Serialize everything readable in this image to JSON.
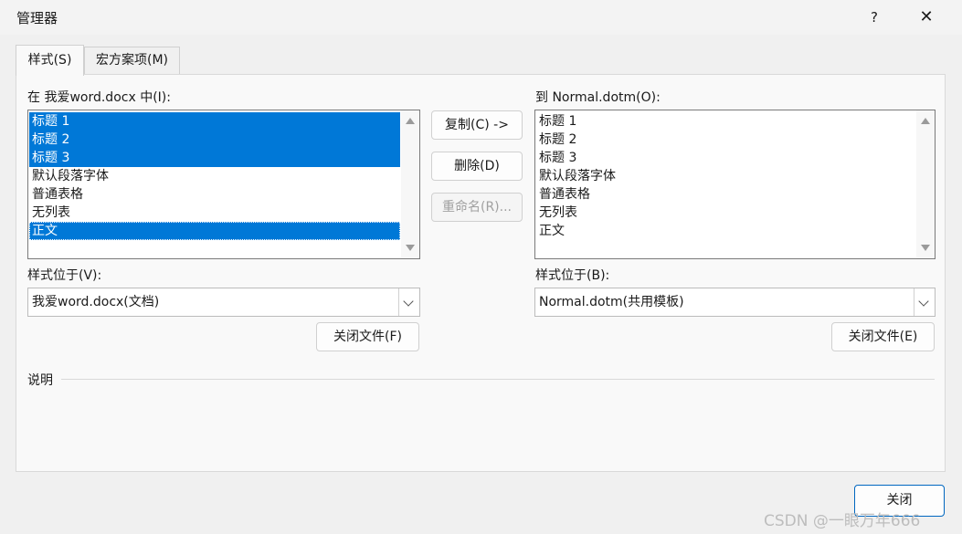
{
  "window": {
    "title": "管理器",
    "help_label": "?",
    "close_glyph": "✕"
  },
  "tabs": [
    {
      "label": "样式(S)",
      "active": true
    },
    {
      "label": "宏方案项(M)",
      "active": false
    }
  ],
  "left": {
    "list_label": "在 我爱word.docx 中(I):",
    "items": [
      {
        "label": "标题 1",
        "selected": true
      },
      {
        "label": "标题 2",
        "selected": true
      },
      {
        "label": "标题 3",
        "selected": true
      },
      {
        "label": "默认段落字体",
        "selected": false
      },
      {
        "label": "普通表格",
        "selected": false
      },
      {
        "label": "无列表",
        "selected": false
      },
      {
        "label": "正文",
        "selected": true
      }
    ],
    "location_label": "样式位于(V):",
    "location_value": "我爱word.docx(文档)",
    "close_file_label": "关闭文件(F)"
  },
  "middle": {
    "copy_label": "复制(C) ->",
    "delete_label": "删除(D)",
    "rename_label": "重命名(R)..."
  },
  "right": {
    "list_label": "到 Normal.dotm(O):",
    "items": [
      {
        "label": "标题 1"
      },
      {
        "label": "标题 2"
      },
      {
        "label": "标题 3"
      },
      {
        "label": "默认段落字体"
      },
      {
        "label": "普通表格"
      },
      {
        "label": "无列表"
      },
      {
        "label": "正文"
      }
    ],
    "location_label": "样式位于(B):",
    "location_value": "Normal.dotm(共用模板)",
    "close_file_label": "关闭文件(E)"
  },
  "description_label": "说明",
  "footer": {
    "close_label": "关闭"
  },
  "watermark": "CSDN @一眼万年666",
  "colors": {
    "selection": "#0078d7",
    "primary_border": "#0067c0"
  }
}
